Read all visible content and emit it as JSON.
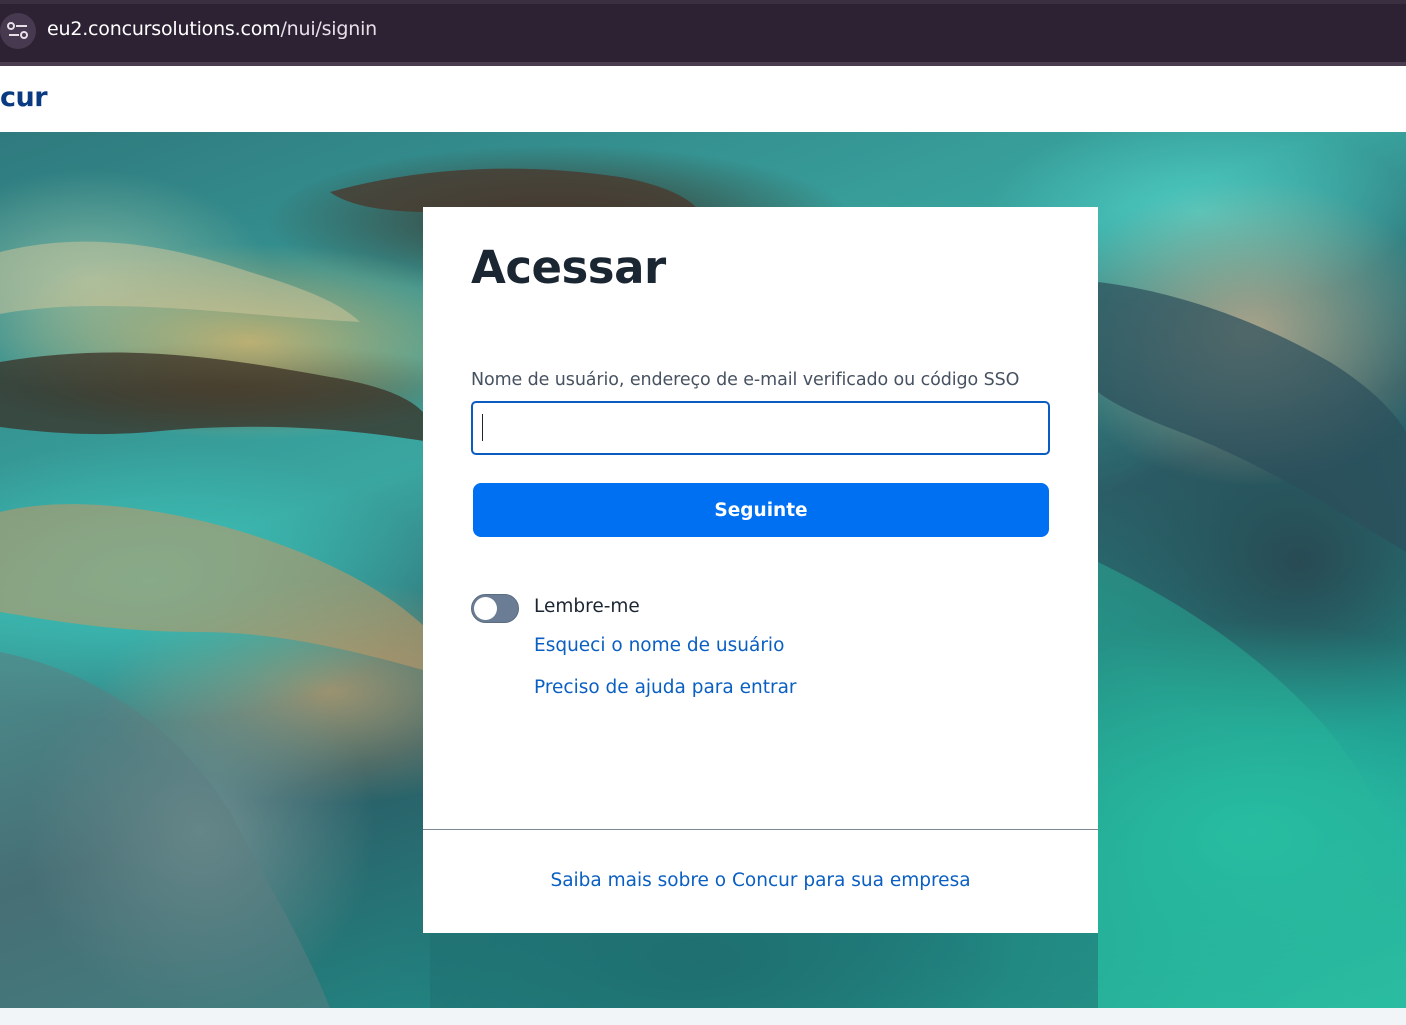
{
  "browser": {
    "url_host": "eu2.concursolutions.com",
    "url_path": "/nui/signin"
  },
  "header": {
    "brand_visible_text": "cur"
  },
  "signin": {
    "title": "Acessar",
    "username_label": "Nome de usuário, endereço de e-mail verificado ou código SSO",
    "username_value": "",
    "next_button": "Seguinte",
    "remember_me_label": "Lembre-me",
    "remember_me_on": false,
    "forgot_username_link": "Esqueci o nome de usuário",
    "help_link": "Preciso de ajuda para entrar",
    "footer_link": "Saiba mais sobre o Concur para sua empresa"
  },
  "colors": {
    "primary_button": "#0070f2",
    "link": "#0a5fc2",
    "title": "#1b2633",
    "browser_bar": "#2d2233"
  },
  "icons": {
    "site_info": "tune-icon"
  }
}
